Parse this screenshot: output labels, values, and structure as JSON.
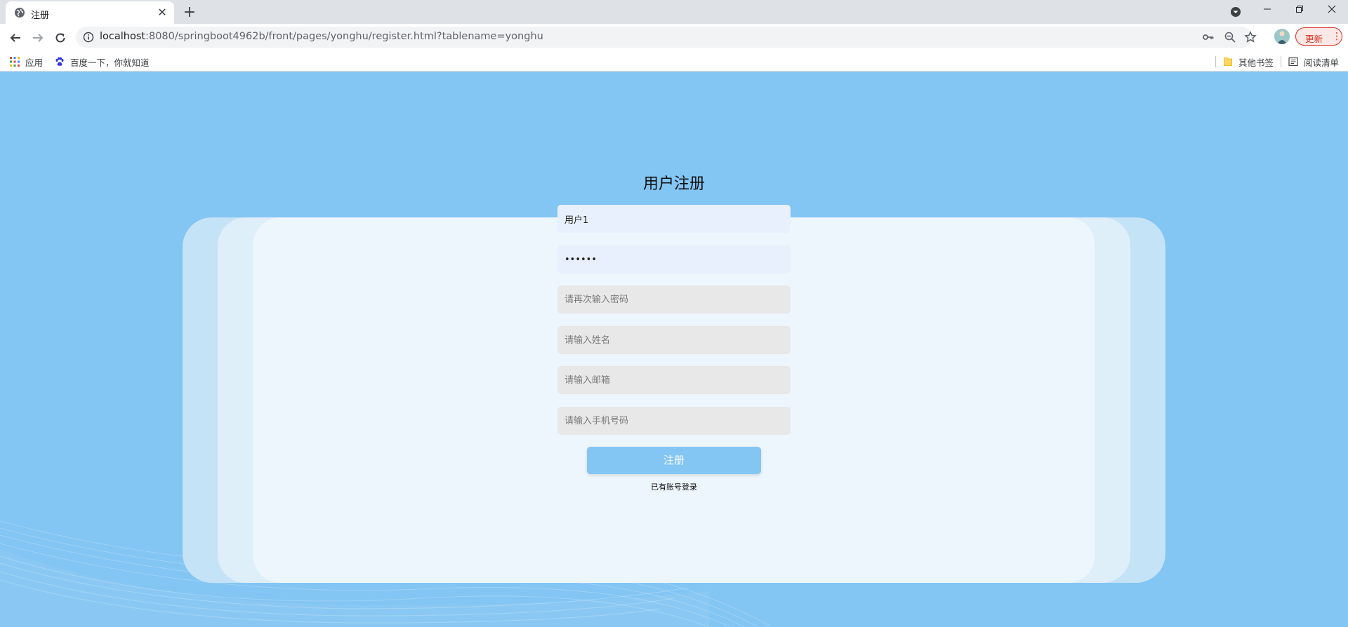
{
  "browser": {
    "tab_title": "注册",
    "url_host": "localhost",
    "url_rest": ":8080/springboot4962b/front/pages/yonghu/register.html?tablename=yonghu",
    "update_label": "更新",
    "bookmarks": {
      "apps": "应用",
      "baidu": "百度一下，你就知道",
      "other": "其他书签",
      "reading_list": "阅读清单"
    }
  },
  "form": {
    "title": "用户注册",
    "username_value": "用户1",
    "password_value": "123456",
    "confirm_password_placeholder": "请再次输入密码",
    "name_placeholder": "请输入姓名",
    "email_placeholder": "请输入邮箱",
    "phone_placeholder": "请输入手机号码",
    "submit_label": "注册",
    "login_link": "已有账号登录"
  },
  "colors": {
    "page_background": "#83c5f3",
    "button": "#83c5f3",
    "card_front": "#eef6fd",
    "card_mid": "#dfeffa",
    "card_back": "#c5e3f7",
    "update_red": "#d93025"
  }
}
